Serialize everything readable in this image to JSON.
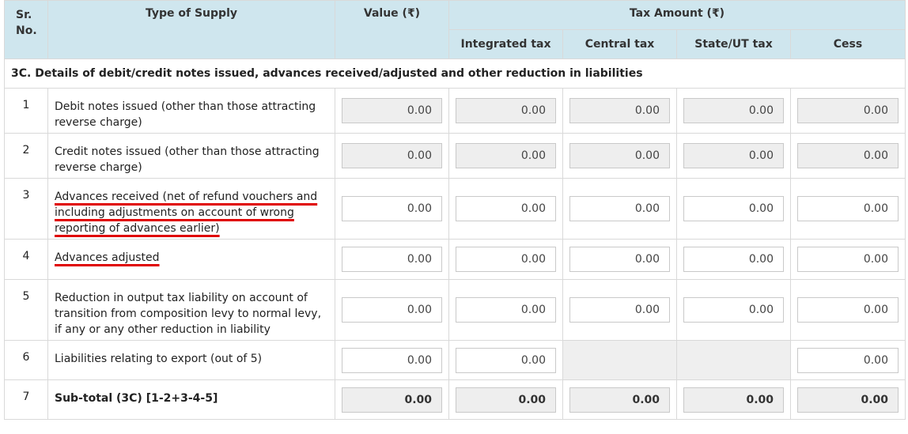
{
  "header": {
    "sr_no": "Sr. No.",
    "type_of_supply": "Type of Supply",
    "value": "Value (₹)",
    "tax_amount": "Tax Amount (₹)",
    "integrated_tax": "Integrated tax",
    "central_tax": "Central tax",
    "state_ut_tax": "State/UT tax",
    "cess": "Cess"
  },
  "section_title": "3C. Details of debit/credit notes issued, advances received/adjusted and other reduction in liabilities",
  "rows": [
    {
      "no": "1",
      "desc": "Debit notes issued (other than those attracting reverse charge)",
      "value": "0.00",
      "integrated": "0.00",
      "central": "0.00",
      "state": "0.00",
      "cess": "0.00"
    },
    {
      "no": "2",
      "desc": "Credit notes issued (other than those attracting reverse charge)",
      "value": "0.00",
      "integrated": "0.00",
      "central": "0.00",
      "state": "0.00",
      "cess": "0.00"
    },
    {
      "no": "3",
      "desc": "Advances received (net of refund vouchers and including adjustments on account of wrong reporting of advances earlier)",
      "value": "0.00",
      "integrated": "0.00",
      "central": "0.00",
      "state": "0.00",
      "cess": "0.00"
    },
    {
      "no": "4",
      "desc": "Advances adjusted",
      "value": "0.00",
      "integrated": "0.00",
      "central": "0.00",
      "state": "0.00",
      "cess": "0.00"
    },
    {
      "no": "5",
      "desc": "Reduction in output tax liability on account of transition from composition levy to normal levy, if any or any other reduction in liability",
      "value": "0.00",
      "integrated": "0.00",
      "central": "0.00",
      "state": "0.00",
      "cess": "0.00"
    },
    {
      "no": "6",
      "desc": "Liabilities relating to export (out of 5)",
      "value": "0.00",
      "integrated": "0.00",
      "cess": "0.00"
    },
    {
      "no": "7",
      "desc": "Sub-total (3C) [1-2+3-4-5]",
      "value": "0.00",
      "integrated": "0.00",
      "central": "0.00",
      "state": "0.00",
      "cess": "0.00"
    }
  ]
}
